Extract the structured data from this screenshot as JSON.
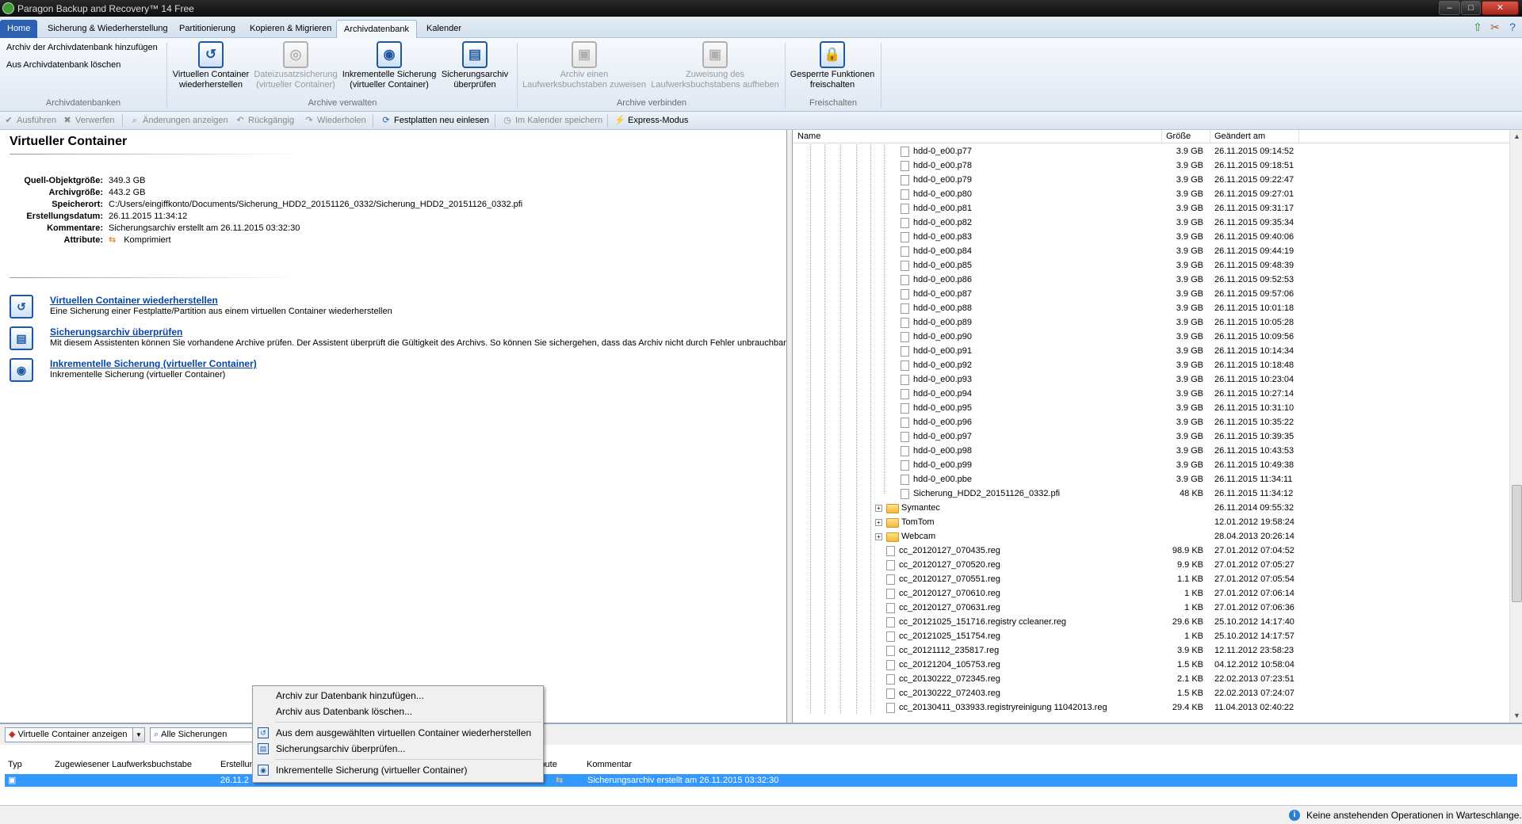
{
  "window": {
    "title": "Paragon Backup and Recovery™ 14 Free"
  },
  "menu": {
    "tabs": [
      "Home",
      "Sicherung & Wiederherstellung",
      "Partitionierung",
      "Kopieren & Migrieren",
      "Archivdatenbank",
      "Kalender"
    ],
    "active": "Archivdatenbank"
  },
  "ribbon": {
    "links": [
      "Archiv der Archivdatenbank hinzufügen",
      "Aus Archivdatenbank löschen"
    ],
    "buttons": [
      {
        "label1": "Virtuellen Container",
        "label2": "wiederherstellen",
        "icon": "restore-vd-icon"
      },
      {
        "label1": "Dateizusatzsicherung",
        "label2": "(virtueller Container)",
        "icon": "file-backup-icon"
      },
      {
        "label1": "Inkrementelle Sicherung",
        "label2": "(virtueller Container)",
        "icon": "incremental-backup-icon"
      },
      {
        "label1": "Sicherungsarchiv",
        "label2": "überprüfen",
        "icon": "verify-archive-icon"
      },
      {
        "label1": "Archiv einen",
        "label2": "Laufwerksbuchstaben zuweisen",
        "icon": "assign-drive-icon"
      },
      {
        "label1": "Zuweisung des",
        "label2": "Laufwerksbuchstabens aufheben",
        "icon": "unassign-drive-icon"
      },
      {
        "label1": "Gesperrte Funktionen",
        "label2": "freischalten",
        "icon": "lock-icon"
      }
    ],
    "groups": [
      "Archivdatenbanken",
      "Archive verwalten",
      "Archive verbinden",
      "Freischalten"
    ]
  },
  "toolbar": {
    "items": [
      "Ausführen",
      "Verwerfen",
      "Änderungen anzeigen",
      "Rückgängig",
      "Wiederholen",
      "Festplatten neu einlesen",
      "Im Kalender speichern",
      "Express-Modus"
    ]
  },
  "details": {
    "title": "Virtueller Container",
    "props": [
      {
        "k": "Quell-Objektgröße:",
        "v": "349.3 GB"
      },
      {
        "k": "Archivgröße:",
        "v": "443.2 GB"
      },
      {
        "k": "Speicherort:",
        "v": "C:/Users/eingiffkonto/Documents/Sicherung_HDD2_20151126_0332/Sicherung_HDD2_20151126_0332.pfi"
      },
      {
        "k": "Erstellungsdatum:",
        "v": "26.11.2015 11:34:12"
      },
      {
        "k": "Kommentare:",
        "v": "Sicherungsarchiv erstellt am 26.11.2015 03:32:30"
      },
      {
        "k": "Attribute:",
        "v": "Komprimiert"
      }
    ],
    "actions": [
      {
        "title": "Virtuellen Container wiederherstellen",
        "desc": "Eine Sicherung einer Festplatte/Partition aus einem virtuellen Container wiederherstellen"
      },
      {
        "title": "Sicherungsarchiv überprüfen",
        "desc": "Mit diesem Assistenten können Sie vorhandene Archive prüfen. Der Assistent überprüft die Gültigkeit des Archivs. So können Sie sichergehen, dass das Archiv nicht durch Fehler unbrauchbar ist."
      },
      {
        "title": "Inkrementelle Sicherung (virtueller Container)",
        "desc": "Inkrementelle Sicherung (virtueller Container)"
      }
    ]
  },
  "filebrowser": {
    "headers": [
      "Name",
      "Größe",
      "Geändert am"
    ],
    "rows": [
      {
        "n": "hdd-0_e00.p77",
        "s": "3.9 GB",
        "d": "26.11.2015 09:14:52",
        "t": "file",
        "lvl": 1
      },
      {
        "n": "hdd-0_e00.p78",
        "s": "3.9 GB",
        "d": "26.11.2015 09:18:51",
        "t": "file",
        "lvl": 1
      },
      {
        "n": "hdd-0_e00.p79",
        "s": "3.9 GB",
        "d": "26.11.2015 09:22:47",
        "t": "file",
        "lvl": 1
      },
      {
        "n": "hdd-0_e00.p80",
        "s": "3.9 GB",
        "d": "26.11.2015 09:27:01",
        "t": "file",
        "lvl": 1
      },
      {
        "n": "hdd-0_e00.p81",
        "s": "3.9 GB",
        "d": "26.11.2015 09:31:17",
        "t": "file",
        "lvl": 1
      },
      {
        "n": "hdd-0_e00.p82",
        "s": "3.9 GB",
        "d": "26.11.2015 09:35:34",
        "t": "file",
        "lvl": 1
      },
      {
        "n": "hdd-0_e00.p83",
        "s": "3.9 GB",
        "d": "26.11.2015 09:40:06",
        "t": "file",
        "lvl": 1
      },
      {
        "n": "hdd-0_e00.p84",
        "s": "3.9 GB",
        "d": "26.11.2015 09:44:19",
        "t": "file",
        "lvl": 1
      },
      {
        "n": "hdd-0_e00.p85",
        "s": "3.9 GB",
        "d": "26.11.2015 09:48:39",
        "t": "file",
        "lvl": 1
      },
      {
        "n": "hdd-0_e00.p86",
        "s": "3.9 GB",
        "d": "26.11.2015 09:52:53",
        "t": "file",
        "lvl": 1
      },
      {
        "n": "hdd-0_e00.p87",
        "s": "3.9 GB",
        "d": "26.11.2015 09:57:06",
        "t": "file",
        "lvl": 1
      },
      {
        "n": "hdd-0_e00.p88",
        "s": "3.9 GB",
        "d": "26.11.2015 10:01:18",
        "t": "file",
        "lvl": 1
      },
      {
        "n": "hdd-0_e00.p89",
        "s": "3.9 GB",
        "d": "26.11.2015 10:05:28",
        "t": "file",
        "lvl": 1
      },
      {
        "n": "hdd-0_e00.p90",
        "s": "3.9 GB",
        "d": "26.11.2015 10:09:56",
        "t": "file",
        "lvl": 1
      },
      {
        "n": "hdd-0_e00.p91",
        "s": "3.9 GB",
        "d": "26.11.2015 10:14:34",
        "t": "file",
        "lvl": 1
      },
      {
        "n": "hdd-0_e00.p92",
        "s": "3.9 GB",
        "d": "26.11.2015 10:18:48",
        "t": "file",
        "lvl": 1
      },
      {
        "n": "hdd-0_e00.p93",
        "s": "3.9 GB",
        "d": "26.11.2015 10:23:04",
        "t": "file",
        "lvl": 1
      },
      {
        "n": "hdd-0_e00.p94",
        "s": "3.9 GB",
        "d": "26.11.2015 10:27:14",
        "t": "file",
        "lvl": 1
      },
      {
        "n": "hdd-0_e00.p95",
        "s": "3.9 GB",
        "d": "26.11.2015 10:31:10",
        "t": "file",
        "lvl": 1
      },
      {
        "n": "hdd-0_e00.p96",
        "s": "3.9 GB",
        "d": "26.11.2015 10:35:22",
        "t": "file",
        "lvl": 1
      },
      {
        "n": "hdd-0_e00.p97",
        "s": "3.9 GB",
        "d": "26.11.2015 10:39:35",
        "t": "file",
        "lvl": 1
      },
      {
        "n": "hdd-0_e00.p98",
        "s": "3.9 GB",
        "d": "26.11.2015 10:43:53",
        "t": "file",
        "lvl": 1
      },
      {
        "n": "hdd-0_e00.p99",
        "s": "3.9 GB",
        "d": "26.11.2015 10:49:38",
        "t": "file",
        "lvl": 1
      },
      {
        "n": "hdd-0_e00.pbe",
        "s": "3.9 GB",
        "d": "26.11.2015 11:34:11",
        "t": "file",
        "lvl": 1
      },
      {
        "n": "Sicherung_HDD2_20151126_0332.pfi",
        "s": "48 KB",
        "d": "26.11.2015 11:34:12",
        "t": "file",
        "lvl": 1
      },
      {
        "n": "Symantec",
        "s": "",
        "d": "26.11.2014 09:55:32",
        "t": "folder",
        "lvl": 0
      },
      {
        "n": "TomTom",
        "s": "",
        "d": "12.01.2012 19:58:24",
        "t": "folder",
        "lvl": 0
      },
      {
        "n": "Webcam",
        "s": "",
        "d": "28.04.2013 20:26:14",
        "t": "folder",
        "lvl": 0
      },
      {
        "n": "cc_20120127_070435.reg",
        "s": "98.9 KB",
        "d": "27.01.2012 07:04:52",
        "t": "file",
        "lvl": 0
      },
      {
        "n": "cc_20120127_070520.reg",
        "s": "9.9 KB",
        "d": "27.01.2012 07:05:27",
        "t": "file",
        "lvl": 0
      },
      {
        "n": "cc_20120127_070551.reg",
        "s": "1.1 KB",
        "d": "27.01.2012 07:05:54",
        "t": "file",
        "lvl": 0
      },
      {
        "n": "cc_20120127_070610.reg",
        "s": "1 KB",
        "d": "27.01.2012 07:06:14",
        "t": "file",
        "lvl": 0
      },
      {
        "n": "cc_20120127_070631.reg",
        "s": "1 KB",
        "d": "27.01.2012 07:06:36",
        "t": "file",
        "lvl": 0
      },
      {
        "n": "cc_20121025_151716.registry ccleaner.reg",
        "s": "29.6 KB",
        "d": "25.10.2012 14:17:40",
        "t": "file",
        "lvl": 0
      },
      {
        "n": "cc_20121025_151754.reg",
        "s": "1 KB",
        "d": "25.10.2012 14:17:57",
        "t": "file",
        "lvl": 0
      },
      {
        "n": "cc_20121112_235817.reg",
        "s": "3.9 KB",
        "d": "12.11.2012 23:58:23",
        "t": "file",
        "lvl": 0
      },
      {
        "n": "cc_20121204_105753.reg",
        "s": "1.5 KB",
        "d": "04.12.2012 10:58:04",
        "t": "file",
        "lvl": 0
      },
      {
        "n": "cc_20130222_072345.reg",
        "s": "2.1 KB",
        "d": "22.02.2013 07:23:51",
        "t": "file",
        "lvl": 0
      },
      {
        "n": "cc_20130222_072403.reg",
        "s": "1.5 KB",
        "d": "22.02.2013 07:24:07",
        "t": "file",
        "lvl": 0
      },
      {
        "n": "cc_20130411_033933.registryreinigung 11042013.reg",
        "s": "29.4 KB",
        "d": "11.04.2013 02:40:22",
        "t": "file",
        "lvl": 0
      }
    ]
  },
  "bottom": {
    "combo1": "Virtuelle Container anzeigen",
    "combo2": "Alle Sicherungen",
    "headers": {
      "typ": "Typ",
      "laufwerk": "Zugewiesener Laufwerksbuchstabe",
      "erstellung": "Erstellung",
      "attribute": "ibute",
      "kommentar": "Kommentar"
    },
    "row": {
      "date": "26.11.2",
      "comment": "Sicherungsarchiv erstellt am 26.11.2015 03:32:30"
    }
  },
  "context_menu": [
    "Archiv zur Datenbank hinzufügen...",
    "Archiv aus Datenbank löschen...",
    "Aus dem ausgewählten virtuellen Container wiederherstellen",
    "Sicherungsarchiv überprüfen...",
    "Inkrementelle Sicherung (virtueller Container)"
  ],
  "status": {
    "text": "Keine anstehenden Operationen in Warteschlange."
  }
}
